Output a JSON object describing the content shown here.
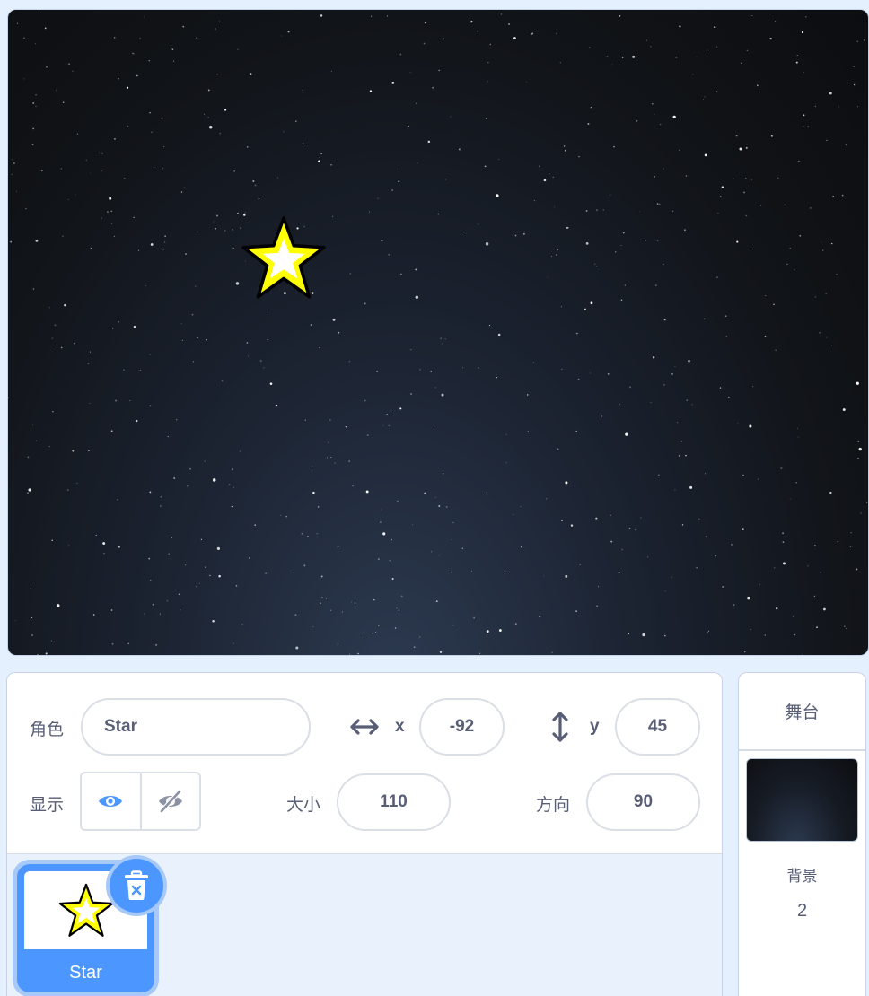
{
  "stage": {
    "sprite_name": "Star"
  },
  "sprite_info": {
    "sprite_label": "角色",
    "sprite_name": "Star",
    "x_label": "x",
    "x_value": "-92",
    "y_label": "y",
    "y_value": "45",
    "show_label": "显示",
    "size_label": "大小",
    "size_value": "110",
    "direction_label": "方向",
    "direction_value": "90"
  },
  "sprite_list": [
    {
      "name": "Star",
      "selected": true
    }
  ],
  "stage_panel": {
    "title": "舞台",
    "backdrops_label": "背景",
    "backdrops_count": "2"
  },
  "colors": {
    "accent": "#4c97ff",
    "panel_bg": "#e9f1fc",
    "text": "#575e75",
    "star_fill": "#ffff00"
  },
  "icons": [
    "x-arrows-icon",
    "y-arrows-icon",
    "eye-icon",
    "eye-off-icon",
    "trash-icon",
    "star-sprite-icon"
  ]
}
